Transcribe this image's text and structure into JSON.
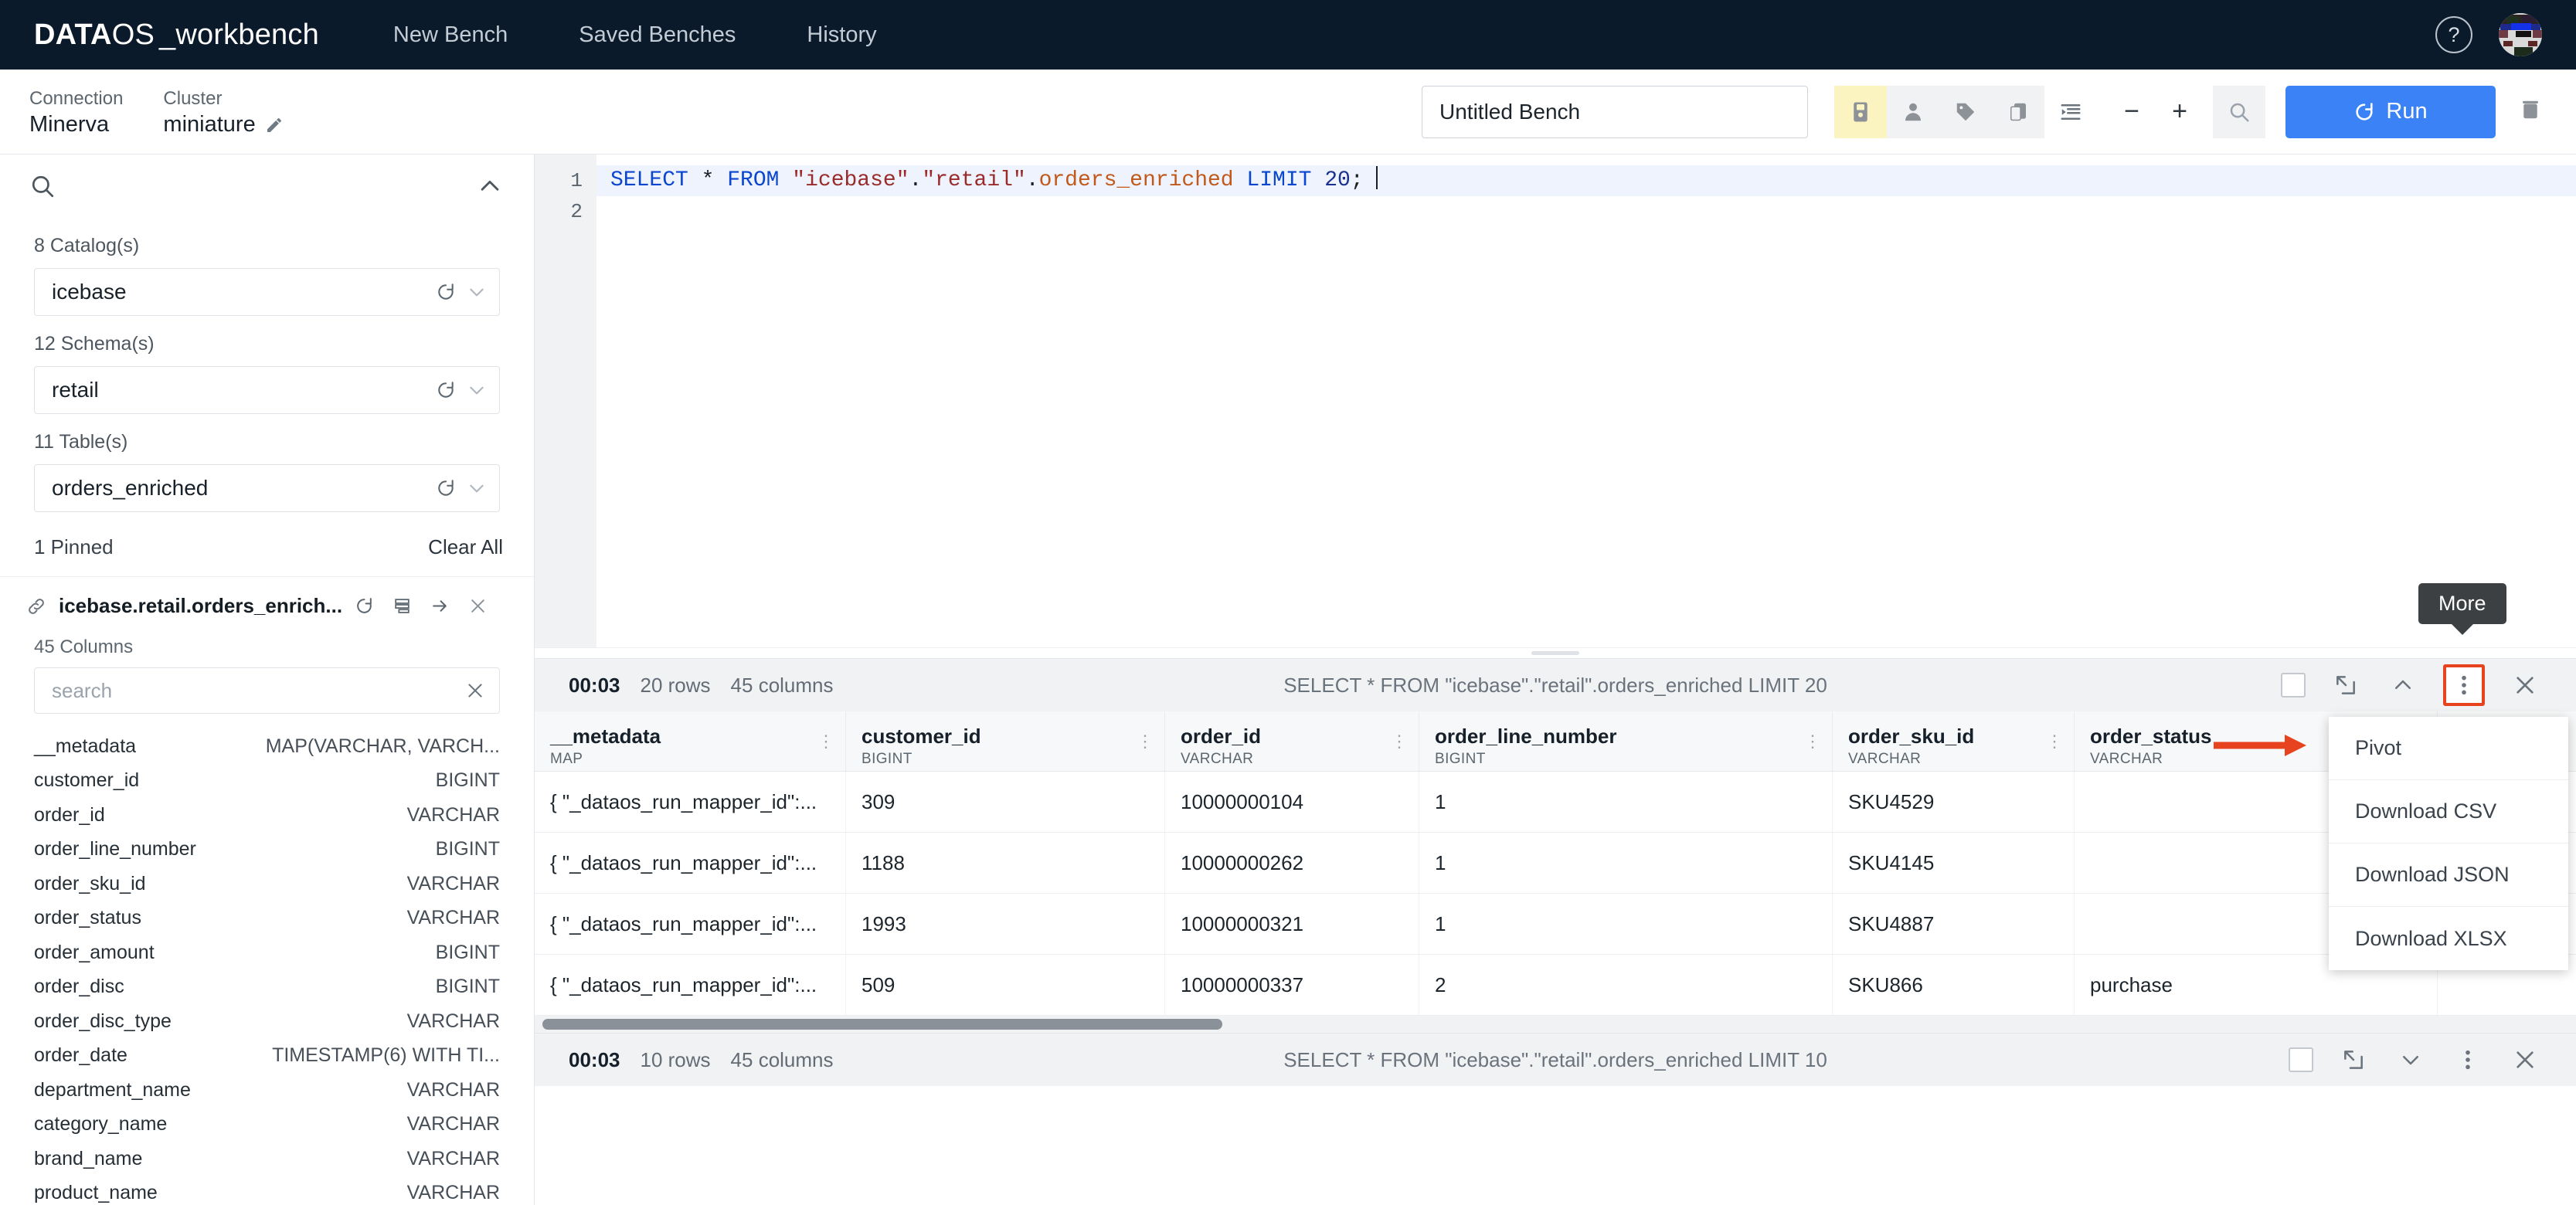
{
  "topnav": {
    "logo": {
      "bold": "DATA",
      "light": "OS",
      "suffix": "_workbench"
    },
    "links": [
      "New Bench",
      "Saved Benches",
      "History"
    ],
    "help_icon": "?",
    "avatar_name": "user-avatar"
  },
  "subbar": {
    "connection_label": "Connection",
    "connection_value": "Minerva",
    "cluster_label": "Cluster",
    "cluster_value": "miniature",
    "edit_icon": "pencil-icon",
    "bench_name_value": "Untitled Bench",
    "bench_name_placeholder": "Untitled Bench",
    "run_label": "Run",
    "toolbar_icons": [
      "save-icon",
      "person-icon",
      "tag-icon",
      "copy-icon",
      "format-icon",
      "minus-icon",
      "plus-icon",
      "search-icon"
    ],
    "zoom_out": "−",
    "zoom_in": "+"
  },
  "sidebar": {
    "search_icon": "search-icon",
    "collapse_icon": "chevron-up-icon",
    "catalog_label": "8 Catalog(s)",
    "catalog_value": "icebase",
    "schema_label": "12 Schema(s)",
    "schema_value": "retail",
    "table_label": "11 Table(s)",
    "table_value": "orders_enriched",
    "pinned_label": "1 Pinned",
    "clear_all_label": "Clear All",
    "pinned_item": "icebase.retail.orders_enrich...",
    "columns_count_label": "45 Columns",
    "search_placeholder": "search",
    "search_value": "",
    "columns": [
      {
        "name": "__metadata",
        "type": "MAP(VARCHAR, VARCH..."
      },
      {
        "name": "customer_id",
        "type": "BIGINT"
      },
      {
        "name": "order_id",
        "type": "VARCHAR"
      },
      {
        "name": "order_line_number",
        "type": "BIGINT"
      },
      {
        "name": "order_sku_id",
        "type": "VARCHAR"
      },
      {
        "name": "order_status",
        "type": "VARCHAR"
      },
      {
        "name": "order_amount",
        "type": "BIGINT"
      },
      {
        "name": "order_disc",
        "type": "BIGINT"
      },
      {
        "name": "order_disc_type",
        "type": "VARCHAR"
      },
      {
        "name": "order_date",
        "type": "TIMESTAMP(6) WITH TI..."
      },
      {
        "name": "department_name",
        "type": "VARCHAR"
      },
      {
        "name": "category_name",
        "type": "VARCHAR"
      },
      {
        "name": "brand_name",
        "type": "VARCHAR"
      },
      {
        "name": "product_name",
        "type": "VARCHAR"
      }
    ]
  },
  "editor": {
    "line_numbers": [
      "1",
      "2"
    ],
    "sql_tokens": [
      {
        "t": "SELECT",
        "c": "kw"
      },
      {
        "t": " * ",
        "c": "punct"
      },
      {
        "t": "FROM",
        "c": "kw"
      },
      {
        "t": " ",
        "c": "punct"
      },
      {
        "t": "\"icebase\"",
        "c": "str"
      },
      {
        "t": ".",
        "c": "punct"
      },
      {
        "t": "\"retail\"",
        "c": "str"
      },
      {
        "t": ".",
        "c": "punct"
      },
      {
        "t": "orders_enriched",
        "c": "ident"
      },
      {
        "t": " ",
        "c": "punct"
      },
      {
        "t": "LIMIT",
        "c": "kw"
      },
      {
        "t": " ",
        "c": "punct"
      },
      {
        "t": "20",
        "c": "num"
      },
      {
        "t": ";",
        "c": "punct"
      }
    ],
    "sql_text": "SELECT * FROM \"icebase\".\"retail\".orders_enriched LIMIT 20;"
  },
  "result_panel_1": {
    "time": "00:03",
    "rows": "20 rows",
    "columns": "45 columns",
    "query": "SELECT * FROM \"icebase\".\"retail\".orders_enriched LIMIT 20",
    "collapse_icon": "chevron-up-icon",
    "expand_icon": "expand-icon",
    "more_icon": "vertical-dots-icon",
    "close_icon": "close-icon",
    "table": {
      "headers": [
        {
          "name": "__metadata",
          "type": "MAP"
        },
        {
          "name": "customer_id",
          "type": "BIGINT"
        },
        {
          "name": "order_id",
          "type": "VARCHAR"
        },
        {
          "name": "order_line_number",
          "type": "BIGINT"
        },
        {
          "name": "order_sku_id",
          "type": "VARCHAR"
        },
        {
          "name": "order_status",
          "type": "VARCHAR"
        }
      ],
      "rows": [
        [
          "{ \"_dataos_run_mapper_id\":...",
          "309",
          "10000000104",
          "1",
          "SKU4529",
          ""
        ],
        [
          "{ \"_dataos_run_mapper_id\":...",
          "1188",
          "10000000262",
          "1",
          "SKU4145",
          ""
        ],
        [
          "{ \"_dataos_run_mapper_id\":...",
          "1993",
          "10000000321",
          "1",
          "SKU4887",
          ""
        ],
        [
          "{ \"_dataos_run_mapper_id\":...",
          "509",
          "10000000337",
          "2",
          "SKU866",
          "purchase"
        ]
      ]
    }
  },
  "result_panel_2": {
    "time": "00:03",
    "rows": "10 rows",
    "columns": "45 columns",
    "query": "SELECT * FROM \"icebase\".\"retail\".orders_enriched LIMIT 10",
    "collapse_icon": "chevron-down-icon",
    "expand_icon": "expand-icon",
    "more_icon": "vertical-dots-icon",
    "close_icon": "close-icon"
  },
  "more_menu": {
    "items": [
      "Pivot",
      "Download CSV",
      "Download JSON",
      "Download XLSX"
    ]
  },
  "tooltip": {
    "text": "More"
  },
  "colors": {
    "nav_bg": "#0a1a2b",
    "accent_blue": "#3b82f6",
    "save_yellow": "#fbf3c0",
    "annotation_red": "#e8431f"
  }
}
